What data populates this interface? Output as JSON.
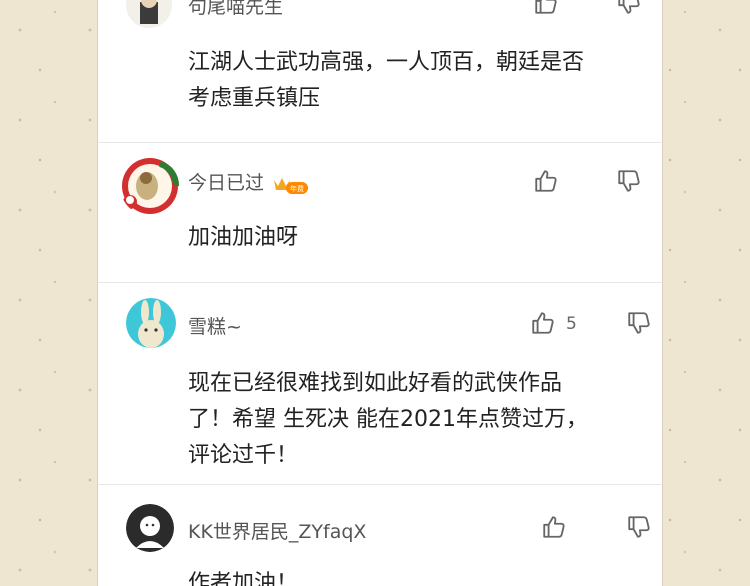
{
  "comments": [
    {
      "username": "句尾喵先生",
      "text_lines": [
        "江湖人士武功高强，一人顶百，朝廷是否",
        "考虑重兵镇压"
      ]
    },
    {
      "username": "今日已过",
      "badge": "年费",
      "text_lines": [
        "加油加油呀"
      ]
    },
    {
      "username": "雪糕~",
      "likes": "5",
      "text_lines": [
        "现在已经很难找到如此好看的武侠作品",
        "了！希望 生死决 能在2021年点赞过万，",
        "评论过千！"
      ]
    },
    {
      "username": "KK世界居民_ZYfaqX",
      "text_lines": [
        "作者加油！"
      ]
    }
  ],
  "colors": {
    "background": "#efe6d2",
    "panel": "#ffffff",
    "text": "#222222",
    "name": "#555555",
    "icon": "#666666"
  }
}
